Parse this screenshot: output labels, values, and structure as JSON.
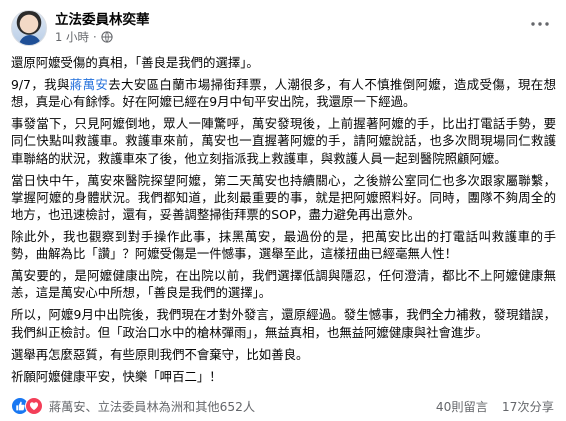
{
  "post": {
    "author": "立法委員林奕華",
    "timestamp": "1 小時",
    "paragraphs": [
      {
        "text": "還原阿嬤受傷的真相，「善良是我們的選擇」。"
      },
      {
        "before": "9/7，我與",
        "link": "蔣萬安",
        "after": "去大安區白蘭市場掃街拜票，人潮很多，有人不慎推倒阿嬤，造成受傷，現在想想，真是心有餘悸。好在阿嬤已經在9月中旬平安出院，我還原一下經過。"
      },
      {
        "text": "事發當下，只見阿嬤倒地，眾人一陣驚呼，萬安發現後，上前握著阿嬤的手，比出打電話手勢，要同仁快點叫救護車。救護車來前，萬安也一直握著阿嬤的手，請阿嬤說話，也多次問現場同仁救護車聯絡的狀況，救護車來了後，他立刻指派我上救護車，與救護人員一起到醫院照顧阿嬤。"
      },
      {
        "text": "當日快中午，萬安來醫院探望阿嬤，第二天萬安也持續關心，之後辦公室同仁也多次跟家屬聯繫，掌握阿嬤的身體狀況。我們都知道，此刻最重要的事，就是把阿嬤照料好。同時，團隊不夠周全的地方，也迅速檢討，還有，妥善調整掃街拜票的SOP，盡力避免再出意外。"
      },
      {
        "text": "除此外，我也觀察到對手操作此事，抹黑萬安，最過份的是，把萬安比出的打電話叫救護車的手勢，曲解為比「讚」？阿嬤受傷是一件憾事，選舉至此，這樣扭曲已經毫無人性！"
      },
      {
        "text": "萬安要的，是阿嬤健康出院，在出院以前，我們選擇低調與隱忍，任何澄清，都比不上阿嬤健康無恙，這是萬安心中所想，「善良是我們的選擇」。"
      },
      {
        "text": "所以，阿嬤9月中出院後，我們現在才對外發言，還原經過。發生憾事，我們全力補救，發現錯誤，我們糾正檢討。但「政治口水中的槍林彈雨」，無益真相，也無益阿嬤健康與社會進步。"
      },
      {
        "text": "選舉再怎麼惡質，有些原則我們不會棄守，比如善良。"
      },
      {
        "text": "祈願阿嬤健康平安，快樂「呷百二」！"
      }
    ]
  },
  "footer": {
    "reactions_text": "蔣萬安、立法委員林為洲和其他652人",
    "comments": "40則留言",
    "shares": "17次分享"
  },
  "colors": {
    "link": "#216fdb",
    "like": "#1877f2",
    "love": "#f33e58",
    "muted": "#65676b"
  },
  "icons": {
    "privacy": "globe-icon",
    "menu": "more-options-icon",
    "reactions": [
      "like-icon",
      "love-icon"
    ]
  }
}
